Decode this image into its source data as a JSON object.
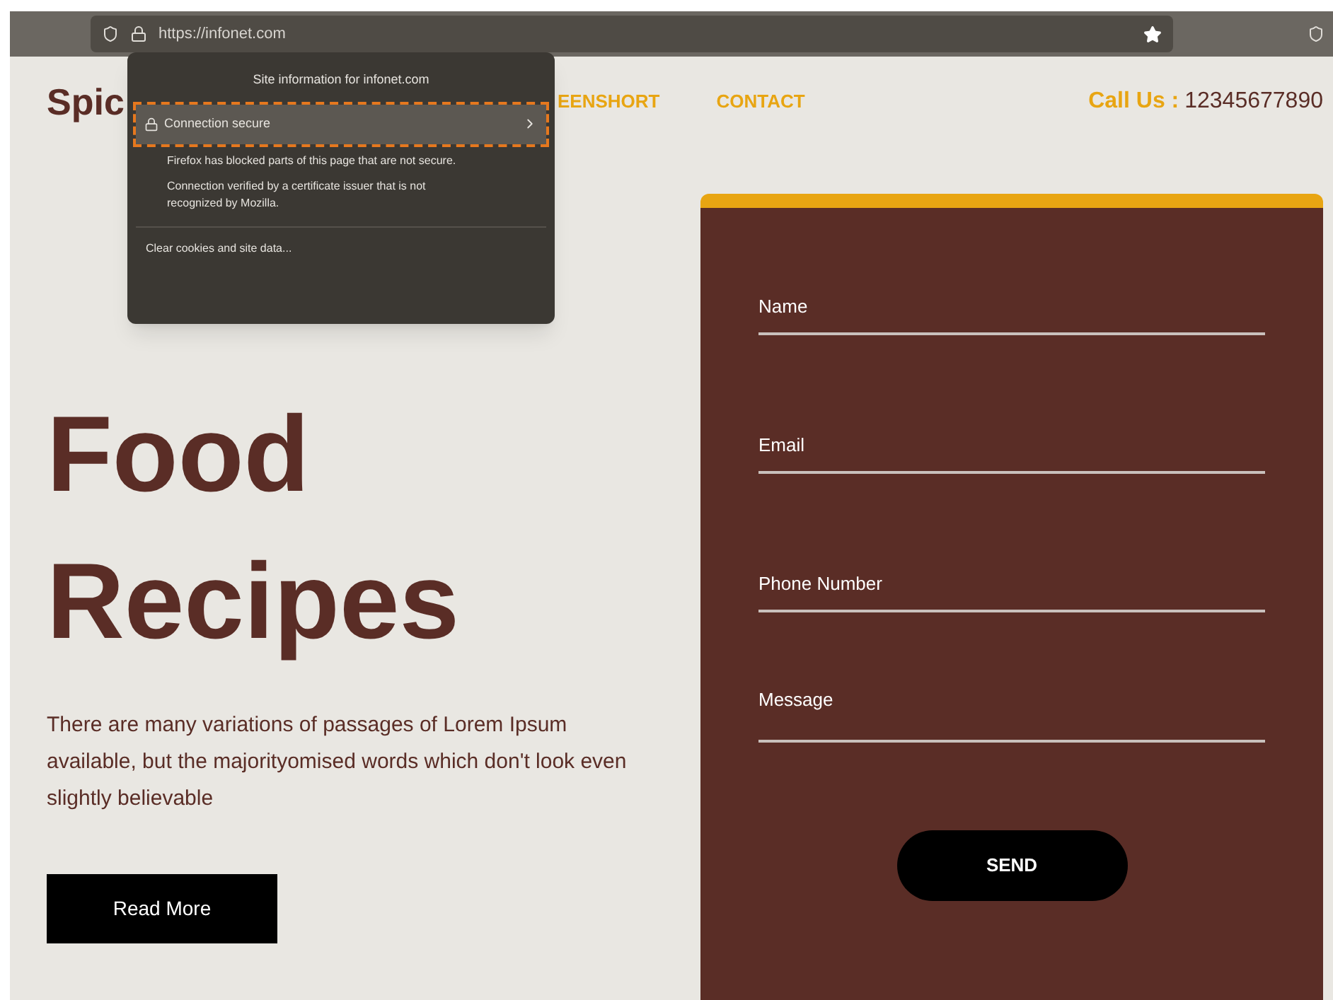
{
  "browser": {
    "url": "https://infonet.com"
  },
  "site_info_popup": {
    "title": "Site information for infonet.com",
    "connection": {
      "label": "Connection secure",
      "selected": true
    },
    "notes": [
      "Firefox has blocked parts of this page that are not secure.",
      "Connection verified by a certificate issuer that is not recognized by Mozilla."
    ],
    "clear_link": "Clear cookies and site data..."
  },
  "header": {
    "logo": "Spic",
    "nav": [
      "EENSHORT",
      "CONTACT"
    ],
    "call_label": "Call Us :",
    "phone": "12345677890"
  },
  "hero": {
    "heading": [
      "Food",
      "Recipes"
    ],
    "text": "There are many variations of passages of Lorem Ipsum available, but the majorityomised words which don't look even slightly believable",
    "button": "Read More"
  },
  "form": {
    "fields": [
      {
        "placeholder": "Name",
        "kind": "input"
      },
      {
        "placeholder": "Email",
        "kind": "input"
      },
      {
        "placeholder": "Phone Number",
        "kind": "input"
      },
      {
        "placeholder": "Message",
        "kind": "textarea"
      }
    ],
    "button": "SEND"
  }
}
